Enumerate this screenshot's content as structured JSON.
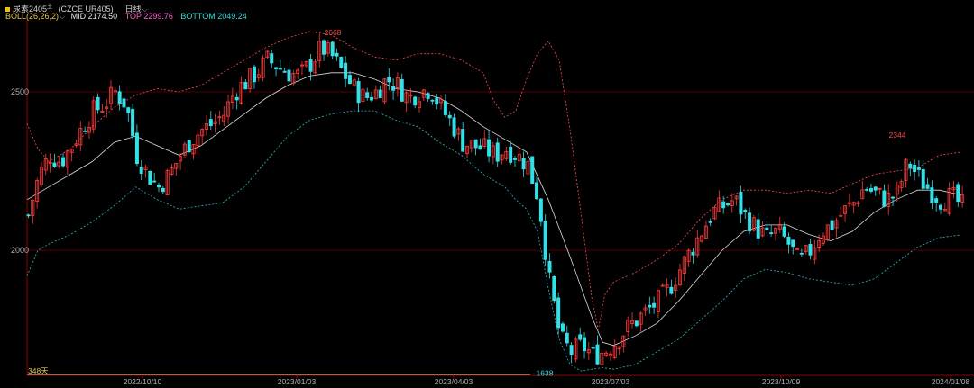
{
  "header": {
    "instrument": "尿素2405",
    "instrument_sup": "主",
    "code": "(CZCE UR405)",
    "period": "日线",
    "indicator": "BOLL(26,26,2)",
    "mid": "MID 2174.50",
    "top": "TOP 2299.76",
    "bottom": "BOTTOM 2049.24",
    "volume_note": "348天"
  },
  "colors": {
    "up": "#ff3b3b",
    "down": "#33e0e8",
    "mid_line": "#dddddd",
    "top_line": "#ff4d4d",
    "bottom_line": "#2fb7c4",
    "grid_red": "#5a0000",
    "axis": "#8a0000",
    "label": "#b0b0b0"
  },
  "chart_data": {
    "type": "candlestick",
    "indicator": "BOLL(26,26,2)",
    "ylim": [
      1620,
      2710
    ],
    "y_ticks": [
      2000,
      2500
    ],
    "x_tick_labels": [
      "2022/10/10",
      "2023/01/03",
      "2023/04/03",
      "2023/07/03",
      "2023/10/09",
      "2024/01/08"
    ],
    "annotations": [
      {
        "label": "2668",
        "value": 2668,
        "kind": "high"
      },
      {
        "label": "1638",
        "value": 1638,
        "kind": "low"
      },
      {
        "label": "2344",
        "value": 2344,
        "kind": "high"
      }
    ],
    "close_path": [
      [
        0,
        2110
      ],
      [
        5,
        2240
      ],
      [
        10,
        2300
      ],
      [
        15,
        2280
      ],
      [
        20,
        2330
      ],
      [
        25,
        2390
      ],
      [
        30,
        2440
      ],
      [
        35,
        2460
      ],
      [
        40,
        2500
      ],
      [
        45,
        2460
      ],
      [
        50,
        2300
      ],
      [
        55,
        2240
      ],
      [
        60,
        2200
      ],
      [
        65,
        2240
      ],
      [
        70,
        2300
      ],
      [
        75,
        2350
      ],
      [
        80,
        2380
      ],
      [
        85,
        2400
      ],
      [
        90,
        2430
      ],
      [
        95,
        2500
      ],
      [
        100,
        2530
      ],
      [
        105,
        2560
      ],
      [
        110,
        2600
      ],
      [
        115,
        2580
      ],
      [
        120,
        2560
      ],
      [
        125,
        2550
      ],
      [
        130,
        2590
      ],
      [
        135,
        2640
      ],
      [
        140,
        2610
      ],
      [
        145,
        2560
      ],
      [
        150,
        2510
      ],
      [
        155,
        2480
      ],
      [
        160,
        2500
      ],
      [
        165,
        2540
      ],
      [
        170,
        2520
      ],
      [
        175,
        2480
      ],
      [
        180,
        2500
      ],
      [
        185,
        2510
      ],
      [
        190,
        2450
      ],
      [
        195,
        2400
      ],
      [
        200,
        2340
      ],
      [
        205,
        2330
      ],
      [
        210,
        2320
      ],
      [
        215,
        2300
      ],
      [
        220,
        2320
      ],
      [
        225,
        2300
      ],
      [
        230,
        2270
      ],
      [
        235,
        2160
      ],
      [
        240,
        1900
      ],
      [
        245,
        1720
      ],
      [
        250,
        1680
      ],
      [
        255,
        1700
      ],
      [
        260,
        1670
      ],
      [
        265,
        1680
      ],
      [
        270,
        1710
      ],
      [
        275,
        1750
      ],
      [
        280,
        1780
      ],
      [
        285,
        1810
      ],
      [
        290,
        1840
      ],
      [
        295,
        1880
      ],
      [
        300,
        1940
      ],
      [
        305,
        2000
      ],
      [
        310,
        2060
      ],
      [
        315,
        2120
      ],
      [
        320,
        2140
      ],
      [
        325,
        2160
      ],
      [
        330,
        2110
      ],
      [
        335,
        2070
      ],
      [
        340,
        2040
      ],
      [
        345,
        2060
      ],
      [
        350,
        2020
      ],
      [
        355,
        1960
      ],
      [
        360,
        2000
      ],
      [
        365,
        2060
      ],
      [
        370,
        2080
      ],
      [
        375,
        2120
      ],
      [
        380,
        2150
      ],
      [
        385,
        2200
      ],
      [
        390,
        2180
      ],
      [
        395,
        2160
      ],
      [
        400,
        2180
      ],
      [
        405,
        2280
      ],
      [
        410,
        2230
      ],
      [
        415,
        2190
      ],
      [
        420,
        2160
      ],
      [
        425,
        2170
      ],
      [
        430,
        2140
      ]
    ],
    "mid_path": [
      [
        0,
        2160
      ],
      [
        10,
        2200
      ],
      [
        20,
        2240
      ],
      [
        30,
        2280
      ],
      [
        40,
        2340
      ],
      [
        50,
        2360
      ],
      [
        60,
        2330
      ],
      [
        70,
        2300
      ],
      [
        80,
        2330
      ],
      [
        90,
        2380
      ],
      [
        100,
        2430
      ],
      [
        110,
        2480
      ],
      [
        120,
        2520
      ],
      [
        130,
        2550
      ],
      [
        140,
        2560
      ],
      [
        150,
        2560
      ],
      [
        160,
        2540
      ],
      [
        170,
        2510
      ],
      [
        180,
        2500
      ],
      [
        190,
        2480
      ],
      [
        200,
        2440
      ],
      [
        210,
        2390
      ],
      [
        220,
        2350
      ],
      [
        230,
        2310
      ],
      [
        240,
        2160
      ],
      [
        250,
        1980
      ],
      [
        260,
        1790
      ],
      [
        265,
        1710
      ],
      [
        270,
        1700
      ],
      [
        280,
        1730
      ],
      [
        290,
        1770
      ],
      [
        300,
        1840
      ],
      [
        310,
        1920
      ],
      [
        320,
        2000
      ],
      [
        330,
        2060
      ],
      [
        340,
        2080
      ],
      [
        350,
        2080
      ],
      [
        360,
        2050
      ],
      [
        370,
        2030
      ],
      [
        380,
        2060
      ],
      [
        390,
        2120
      ],
      [
        400,
        2160
      ],
      [
        410,
        2190
      ],
      [
        420,
        2190
      ],
      [
        430,
        2175
      ]
    ],
    "top_path": [
      [
        0,
        2400
      ],
      [
        5,
        2320
      ],
      [
        10,
        2280
      ],
      [
        20,
        2320
      ],
      [
        30,
        2390
      ],
      [
        40,
        2450
      ],
      [
        50,
        2490
      ],
      [
        60,
        2510
      ],
      [
        70,
        2500
      ],
      [
        80,
        2520
      ],
      [
        90,
        2560
      ],
      [
        100,
        2600
      ],
      [
        110,
        2640
      ],
      [
        120,
        2670
      ],
      [
        130,
        2690
      ],
      [
        140,
        2680
      ],
      [
        150,
        2640
      ],
      [
        160,
        2610
      ],
      [
        170,
        2600
      ],
      [
        180,
        2620
      ],
      [
        190,
        2620
      ],
      [
        200,
        2600
      ],
      [
        210,
        2560
      ],
      [
        215,
        2470
      ],
      [
        220,
        2420
      ],
      [
        225,
        2440
      ],
      [
        230,
        2540
      ],
      [
        235,
        2620
      ],
      [
        240,
        2660
      ],
      [
        245,
        2600
      ],
      [
        250,
        2380
      ],
      [
        255,
        2120
      ],
      [
        260,
        1850
      ],
      [
        263,
        1750
      ],
      [
        266,
        1860
      ],
      [
        270,
        1900
      ],
      [
        280,
        1930
      ],
      [
        290,
        1970
      ],
      [
        300,
        2020
      ],
      [
        310,
        2100
      ],
      [
        320,
        2160
      ],
      [
        330,
        2190
      ],
      [
        340,
        2190
      ],
      [
        350,
        2180
      ],
      [
        360,
        2190
      ],
      [
        370,
        2180
      ],
      [
        380,
        2210
      ],
      [
        390,
        2240
      ],
      [
        400,
        2250
      ],
      [
        410,
        2260
      ],
      [
        420,
        2300
      ],
      [
        430,
        2310
      ]
    ],
    "bottom_path": [
      [
        0,
        1920
      ],
      [
        5,
        2000
      ],
      [
        10,
        2020
      ],
      [
        20,
        2050
      ],
      [
        30,
        2090
      ],
      [
        40,
        2140
      ],
      [
        50,
        2200
      ],
      [
        60,
        2160
      ],
      [
        70,
        2130
      ],
      [
        80,
        2140
      ],
      [
        90,
        2150
      ],
      [
        100,
        2200
      ],
      [
        110,
        2280
      ],
      [
        120,
        2360
      ],
      [
        130,
        2410
      ],
      [
        140,
        2430
      ],
      [
        150,
        2440
      ],
      [
        160,
        2440
      ],
      [
        170,
        2410
      ],
      [
        180,
        2390
      ],
      [
        190,
        2340
      ],
      [
        200,
        2300
      ],
      [
        210,
        2240
      ],
      [
        220,
        2200
      ],
      [
        225,
        2160
      ],
      [
        230,
        2130
      ],
      [
        235,
        2060
      ],
      [
        240,
        1880
      ],
      [
        245,
        1720
      ],
      [
        250,
        1640
      ],
      [
        255,
        1620
      ],
      [
        260,
        1625
      ],
      [
        265,
        1630
      ],
      [
        270,
        1625
      ],
      [
        280,
        1640
      ],
      [
        290,
        1680
      ],
      [
        300,
        1720
      ],
      [
        310,
        1780
      ],
      [
        320,
        1840
      ],
      [
        330,
        1910
      ],
      [
        340,
        1940
      ],
      [
        350,
        1930
      ],
      [
        360,
        1910
      ],
      [
        370,
        1900
      ],
      [
        380,
        1890
      ],
      [
        390,
        1910
      ],
      [
        400,
        1960
      ],
      [
        410,
        2010
      ],
      [
        420,
        2040
      ],
      [
        430,
        2049
      ]
    ]
  }
}
